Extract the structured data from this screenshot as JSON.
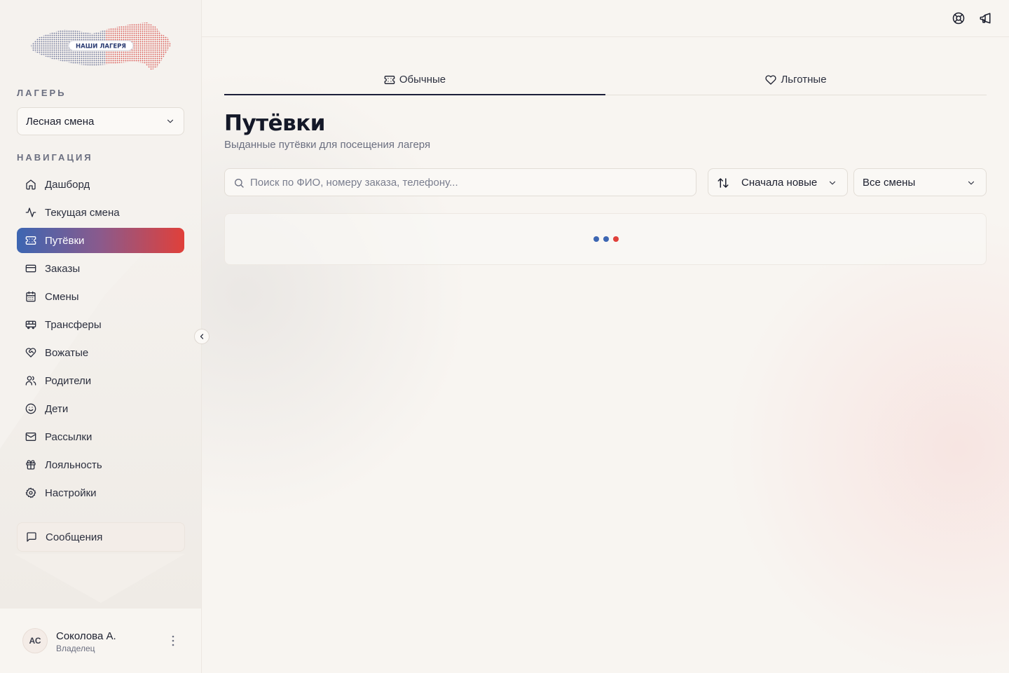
{
  "brand": {
    "logo_text": "НАШИ ЛАГЕРЯ"
  },
  "sidebar": {
    "camp_label": "ЛАГЕРЬ",
    "camp_value": "Лесная смена",
    "nav_label": "НАВИГАЦИЯ",
    "items": [
      {
        "label": "Дашборд",
        "icon": "home-icon"
      },
      {
        "label": "Текущая смена",
        "icon": "activity-icon"
      },
      {
        "label": "Путёвки",
        "icon": "ticket-icon",
        "active": true
      },
      {
        "label": "Заказы",
        "icon": "credit-card-icon"
      },
      {
        "label": "Смены",
        "icon": "calendar-icon"
      },
      {
        "label": "Трансферы",
        "icon": "bus-icon"
      },
      {
        "label": "Вожатые",
        "icon": "heart-handshake-icon"
      },
      {
        "label": "Родители",
        "icon": "users-icon"
      },
      {
        "label": "Дети",
        "icon": "smile-icon"
      },
      {
        "label": "Рассылки",
        "icon": "mail-icon"
      },
      {
        "label": "Лояльность",
        "icon": "gift-icon"
      },
      {
        "label": "Настройки",
        "icon": "settings-icon"
      }
    ],
    "messages_label": "Сообщения",
    "user": {
      "initials": "АС",
      "name": "Соколова А.",
      "role": "Владелец"
    }
  },
  "main": {
    "tabs": [
      {
        "label": "Обычные",
        "icon": "ticket-icon",
        "active": true
      },
      {
        "label": "Льготные",
        "icon": "heart-icon",
        "active": false
      }
    ],
    "title": "Путёвки",
    "subtitle": "Выданные путёвки для посещения лагеря",
    "search": {
      "placeholder": "Поиск по ФИО, номеру заказа, телефону...",
      "value": ""
    },
    "sort": {
      "value": "Сначала новые"
    },
    "shift_filter": {
      "value": "Все смены"
    },
    "loading_dots": [
      "#3d66b2",
      "#3d66b2",
      "#e0403a"
    ]
  },
  "colors": {
    "accent_blue": "#3d66b2",
    "accent_red": "#e0403a",
    "background": "#f8f5f1"
  }
}
